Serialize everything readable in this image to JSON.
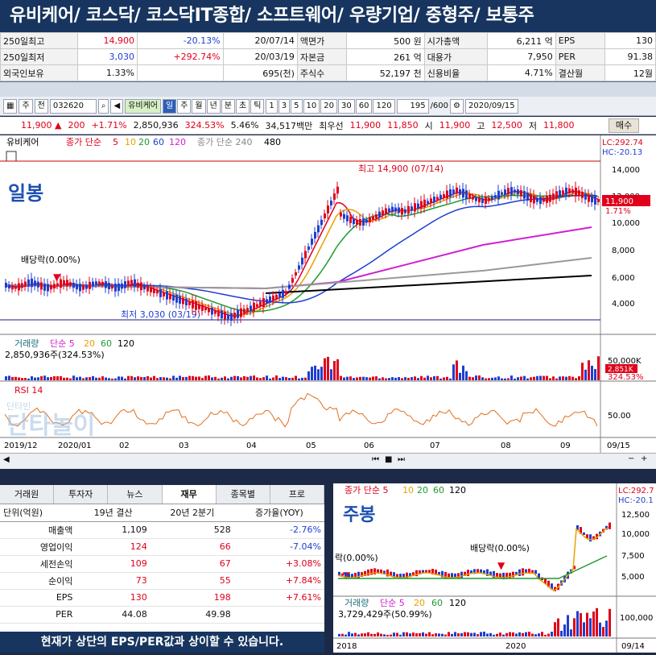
{
  "banner": {
    "title": "유비케어/ 코스닥/ 코스닥IT종합/ 소프트웨어/ 우량기업/ 중형주/ 보통주"
  },
  "summary": {
    "rows": [
      {
        "l1": "250일최고",
        "v1": "14,900",
        "p1": "-20.13%",
        "d1": "20/07/14",
        "l2": "액면가",
        "v2": "500 원",
        "l3": "시가총액",
        "v3": "6,211 억",
        "l4": "EPS",
        "v4": "130"
      },
      {
        "l1": "250일최저",
        "v1": "3,030",
        "p1": "+292.74%",
        "d1": "20/03/19",
        "l2": "자본금",
        "v2": "261 억",
        "l3": "대용가",
        "v3": "7,950",
        "l4": "PER",
        "v4": "91.38"
      },
      {
        "l1": "외국인보유",
        "v1": "1.33%",
        "p1": "",
        "d1": "695(천)",
        "l2": "주식수",
        "v2": "52,197 천",
        "l3": "신용비율",
        "v3": "4.71%",
        "l4": "결산월",
        "v4": "12월"
      }
    ]
  },
  "toolbar": {
    "type": "주",
    "prev": "전",
    "code": "032620",
    "stock_name": "유비케어",
    "periods": [
      "일",
      "주",
      "월",
      "년",
      "분",
      "초",
      "틱"
    ],
    "nums": [
      "1",
      "3",
      "5",
      "10",
      "20",
      "30",
      "60",
      "120"
    ],
    "count": "195",
    "total": "/600",
    "date": "2020/09/15"
  },
  "pricebar": {
    "price": "11,900",
    "change": "200",
    "change_pct": "+1.71%",
    "volume": "2,850,936",
    "vol_pct": "324.53%",
    "turnover": "5.46%",
    "amount": "34,517백만",
    "best_label": "최우선",
    "best_bid": "11,900",
    "best_ask": "11,850",
    "open_label": "시",
    "open": "11,900",
    "high_label": "고",
    "high": "12,500",
    "low_label": "저",
    "low": "11,800",
    "buy": "매수"
  },
  "daily": {
    "legend_name": "유비케어",
    "legend_ma": "종가 단순",
    "legend_ma_nums": [
      "5",
      "10",
      "20",
      "60",
      "120"
    ],
    "legend_long": "종가 단순 240",
    "legend_long_num": "480",
    "label": "일봉",
    "hi_note": "최고 14,900 (07/14)",
    "lo_note": "최저 3,030 (03/19)",
    "div_note": "배당락(0.00%)",
    "lc": "LC:292.74",
    "hc": "HC:-20.13",
    "y_ticks": [
      "14,000",
      "12,000",
      "10,000",
      "8,000",
      "6,000",
      "4,000"
    ],
    "cur_price": "11,900",
    "cur_pct": "1.71%",
    "vol_legend": "거래량",
    "vol_ma": "단순 5",
    "vol_nums": [
      "20",
      "60",
      "120"
    ],
    "vol_info": "2,850,936주(324.53%)",
    "vol_tick": "50,000K",
    "vol_cur": "2,851K",
    "vol_pct": "324.53%",
    "rsi_label": "RSI 14",
    "rsi_tick": "50.00",
    "x_ticks": [
      "2019/12",
      "2020/01",
      "02",
      "03",
      "04",
      "05",
      "06",
      "07",
      "08",
      "09",
      "09/15"
    ],
    "watermark": "단타놀이",
    "watermark_small": "단타빈"
  },
  "financial": {
    "tabs": [
      "거래원",
      "투자자",
      "뉴스",
      "재무",
      "종목별",
      "프로"
    ],
    "headers": [
      "단위(억원)",
      "19년 결산",
      "20년 2분기",
      "증가율(YOY)"
    ],
    "rows": [
      {
        "name": "매출액",
        "a": "1,109",
        "b": "528",
        "c": "-2.76%"
      },
      {
        "name": "영업이익",
        "a": "124",
        "b": "66",
        "c": "-7.04%"
      },
      {
        "name": "세전손익",
        "a": "109",
        "b": "67",
        "c": "+3.08%"
      },
      {
        "name": "순이익",
        "a": "73",
        "b": "55",
        "c": "+7.84%"
      },
      {
        "name": "EPS",
        "a": "130",
        "b": "198",
        "c": "+7.61%"
      },
      {
        "name": "PER",
        "a": "44.08",
        "b": "49.98",
        "c": ""
      }
    ],
    "caption": "현재가 상단의 EPS/PER값과 상이할 수 있습니다."
  },
  "weekly": {
    "legend": "종가 단순 5",
    "nums": [
      "10",
      "20",
      "60",
      "120"
    ],
    "label": "주봉",
    "lc": "LC:292.7",
    "hc": "HC:-20.1",
    "y_ticks": [
      "12,500",
      "10,000",
      "7,500",
      "5,000"
    ],
    "div1": "락(0.00%)",
    "div2": "배당락(0.00%)",
    "vol_legend": "거래량",
    "vol_ma": "단순 5",
    "vol_nums": [
      "20",
      "60",
      "120"
    ],
    "vol_info": "3,729,429주(50.99%)",
    "vol_tick": "100,000",
    "x_ticks": [
      "2018",
      "2020",
      "09/14"
    ]
  },
  "colors": {
    "up": "#e0001b",
    "down": "#1d3fd0",
    "banner": "#17355f"
  }
}
